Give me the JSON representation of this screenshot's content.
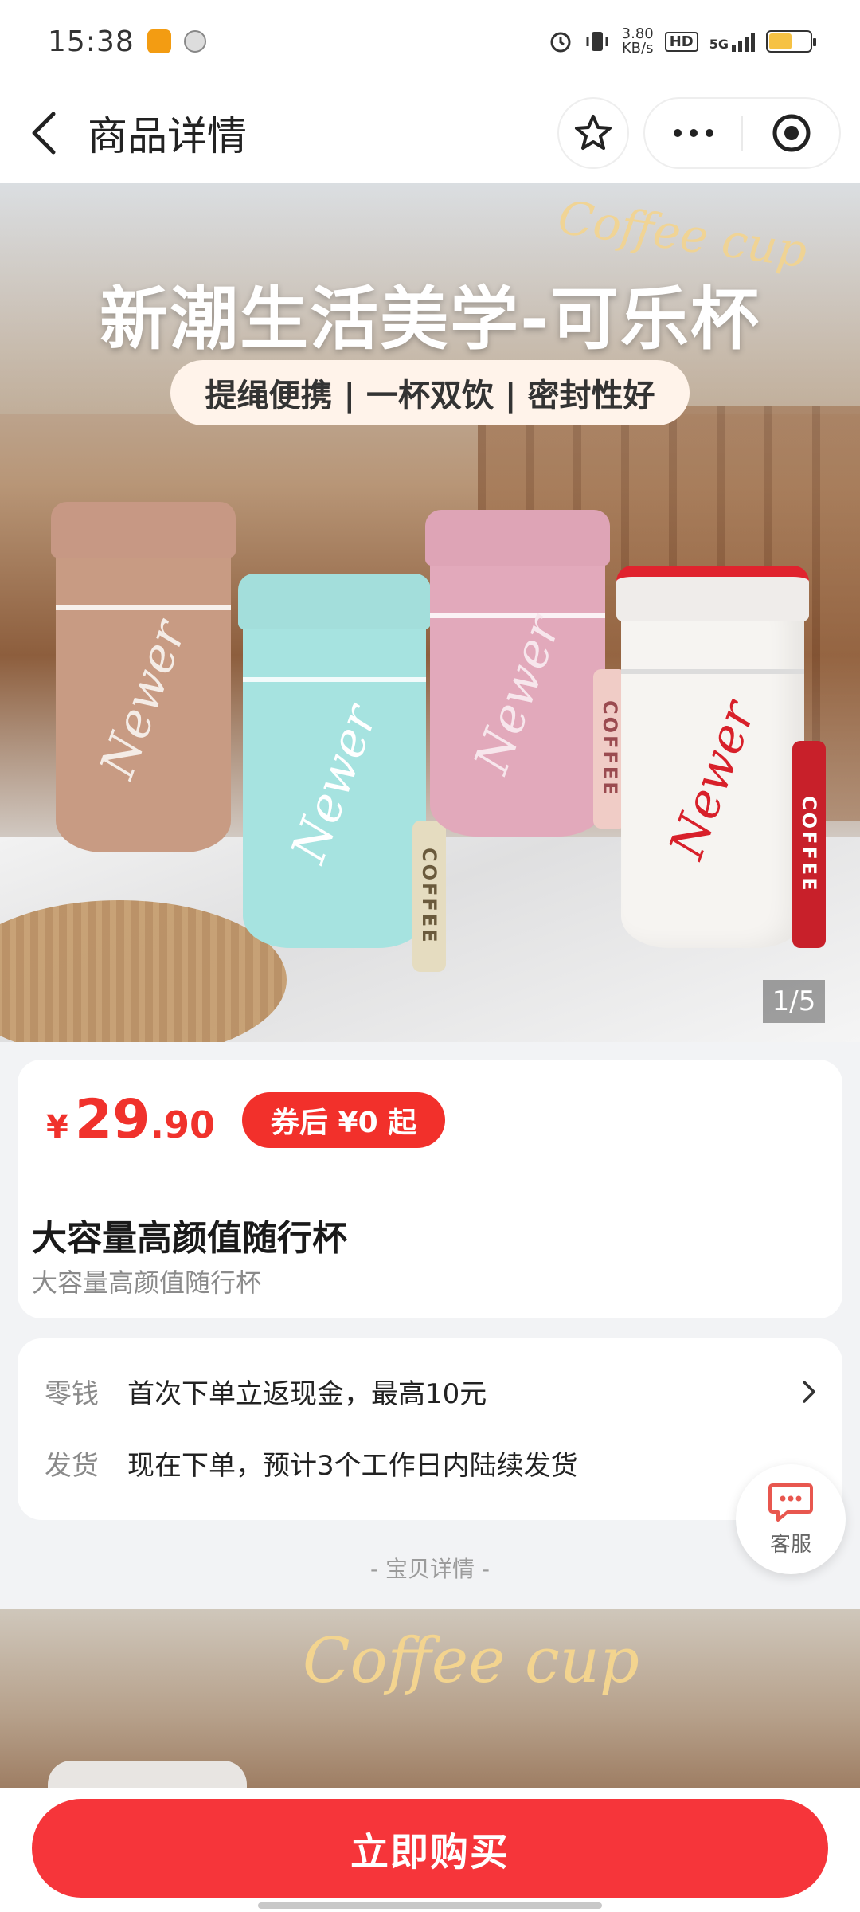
{
  "status_bar": {
    "time": "15:38",
    "net_speed_value": "3.80",
    "net_speed_unit": "KB/s",
    "hd_label": "HD",
    "network_label": "5G",
    "battery_level": 0.55,
    "battery_color": "#f6c244"
  },
  "nav": {
    "title": "商品详情"
  },
  "hero": {
    "headline": "新潮生活美学-可乐杯",
    "script_text": "Coffee cup",
    "features": "提绳便携 | 一杯双饮 | 密封性好",
    "brand_text": "Newer",
    "strap_text": "COFFEE",
    "page_indicator": "1/5"
  },
  "price": {
    "currency": "¥",
    "integer": "29",
    "decimal": ".90",
    "coupon": "券后 ¥0 起",
    "color": "#f0322c"
  },
  "product": {
    "title": "大容量高颜值随行杯",
    "subtitle": "大容量高颜值随行杯"
  },
  "info": {
    "rows": [
      {
        "label": "零钱",
        "text": "首次下单立返现金，最高10元"
      },
      {
        "label": "发货",
        "text": "现在下单，预计3个工作日内陆续发货"
      }
    ]
  },
  "customer_service": {
    "label": "客服"
  },
  "details": {
    "divider": "- 宝贝详情 -",
    "script_text": "Coffee cup"
  },
  "bottom": {
    "buy_label": "立即购买",
    "accent": "#f6353a"
  }
}
